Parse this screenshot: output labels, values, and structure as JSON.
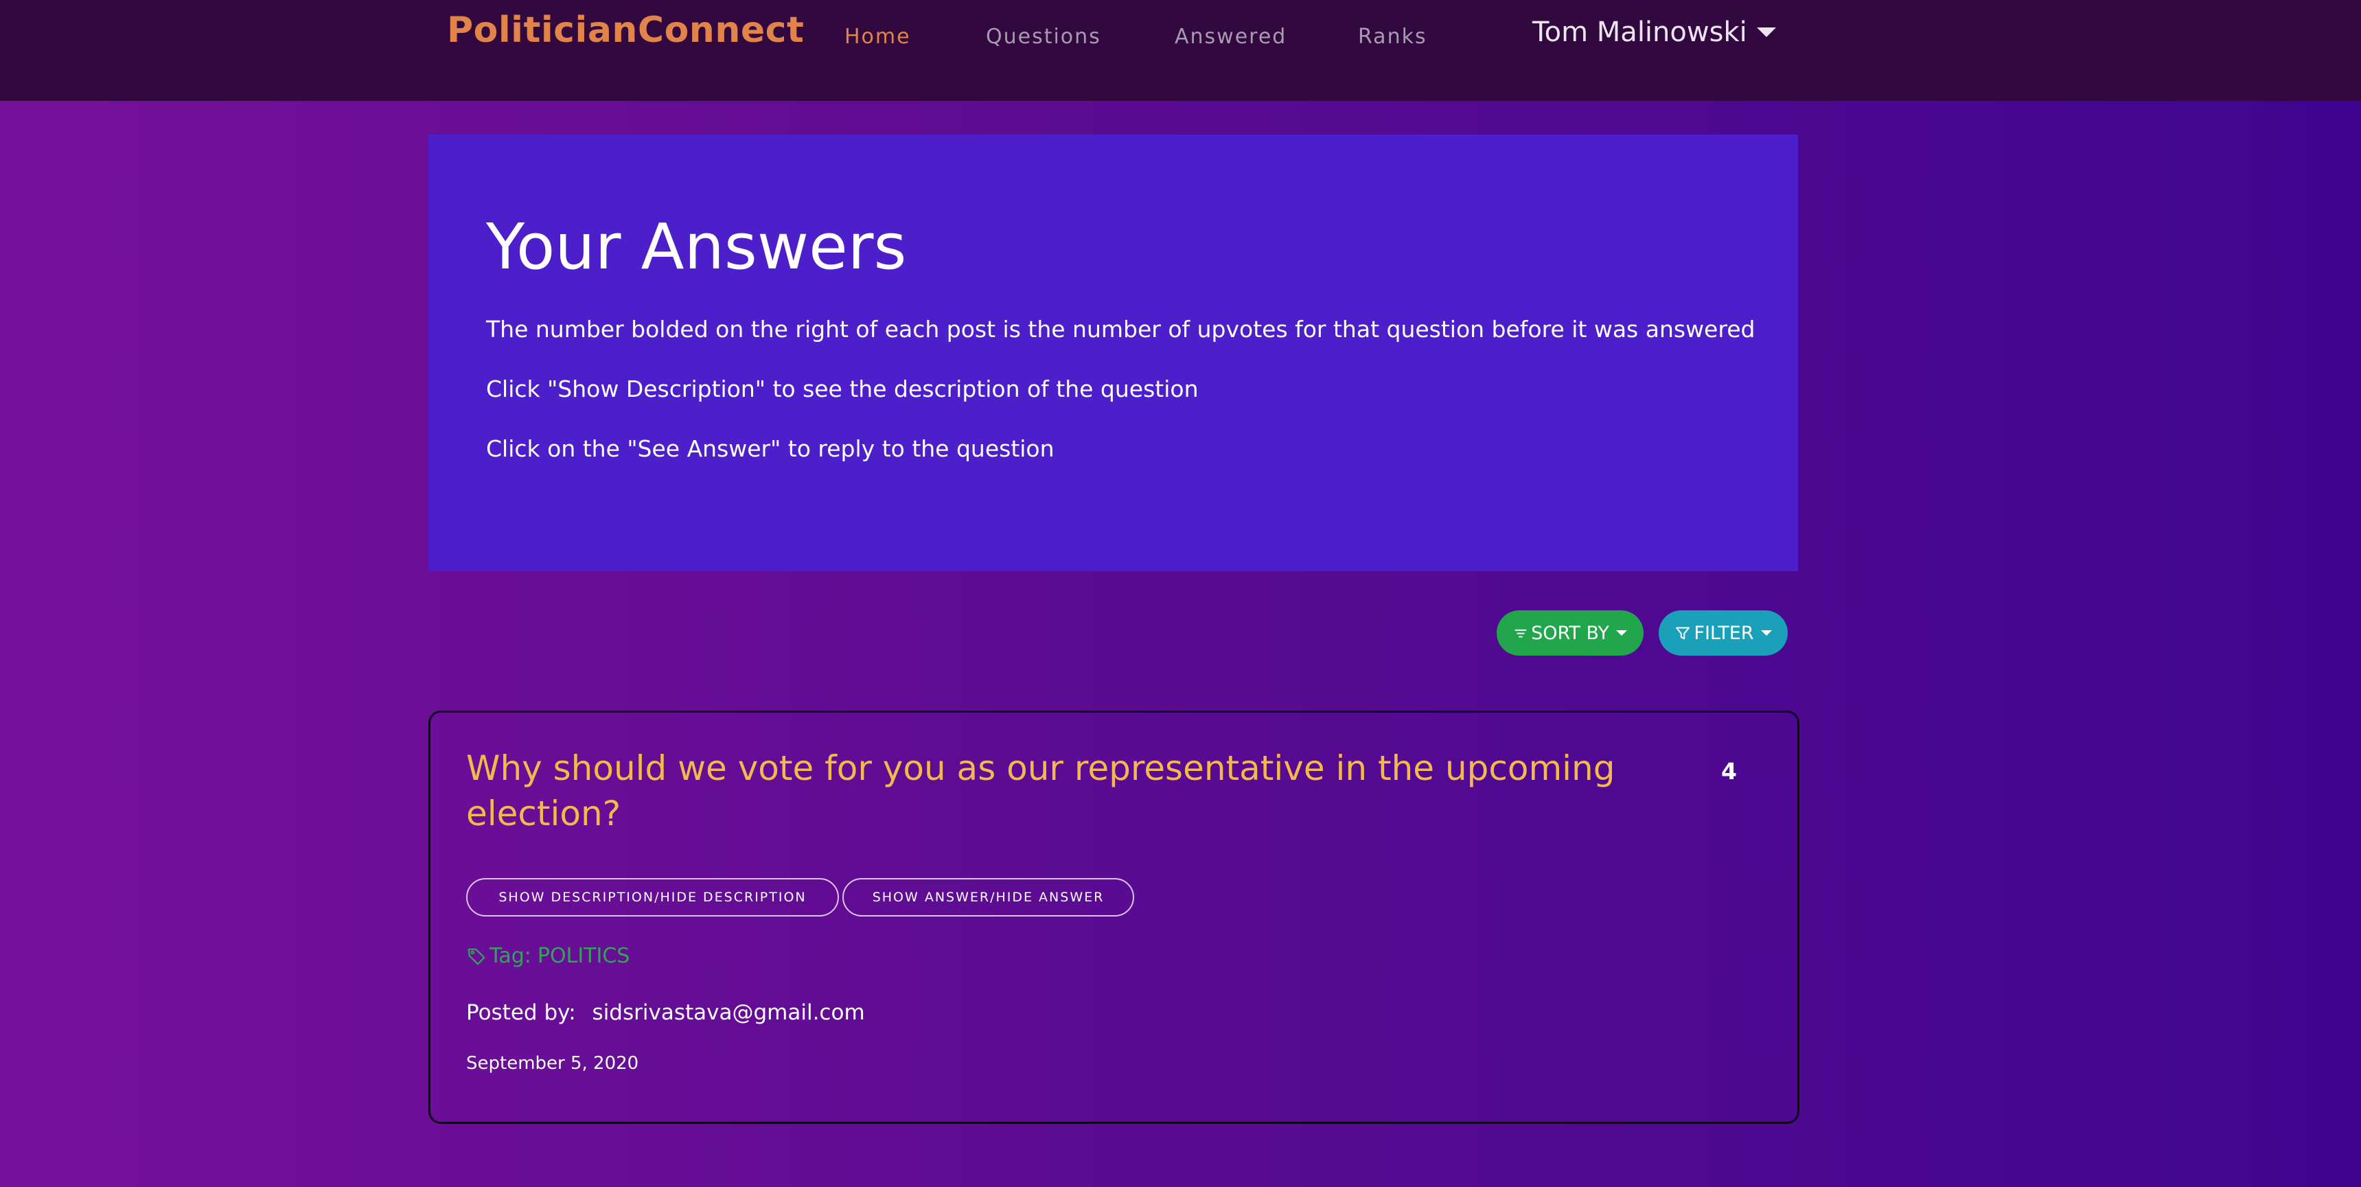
{
  "navbar": {
    "brand": "PoliticianConnect",
    "links": [
      {
        "label": "Home",
        "active": true
      },
      {
        "label": "Questions",
        "active": false
      },
      {
        "label": "Answered",
        "active": false
      },
      {
        "label": "Ranks",
        "active": false
      }
    ],
    "user": {
      "name": "Tom Malinowski",
      "icon": "caret-down-icon"
    }
  },
  "jumbotron": {
    "title": "Your Answers",
    "lines": [
      "The number bolded on the right of each post is the number of upvotes for that question before it was answered",
      "Click \"Show Description\" to see the description of the question",
      "Click on the \"See Answer\" to reply to the question"
    ]
  },
  "controls": {
    "sort": {
      "label": "SORT BY",
      "icon": "sort-icon",
      "color": "#22a64b"
    },
    "filter": {
      "label": "FILTER",
      "icon": "filter-icon",
      "color": "#1aa0b8"
    }
  },
  "questions": [
    {
      "title": "Why should we vote for you as our representative in the upcoming election?",
      "upvotes": "4",
      "description_button": "Show Description/Hide Description",
      "answer_button": "Show Answer/Hide Answer",
      "tag_label": "Tag:",
      "tag_value": "POLITICS",
      "tag_icon": "tag-icon",
      "posted_label": "Posted by:",
      "posted_by": "sidsrivastava@gmail.com",
      "date": "September 5, 2020"
    }
  ],
  "colors": {
    "brand": "#e2834a",
    "navbar_bg": "#31093f",
    "jumbotron_bg": "#4c1fca",
    "question_title": "#f3b94b",
    "tag": "#31a35a"
  }
}
